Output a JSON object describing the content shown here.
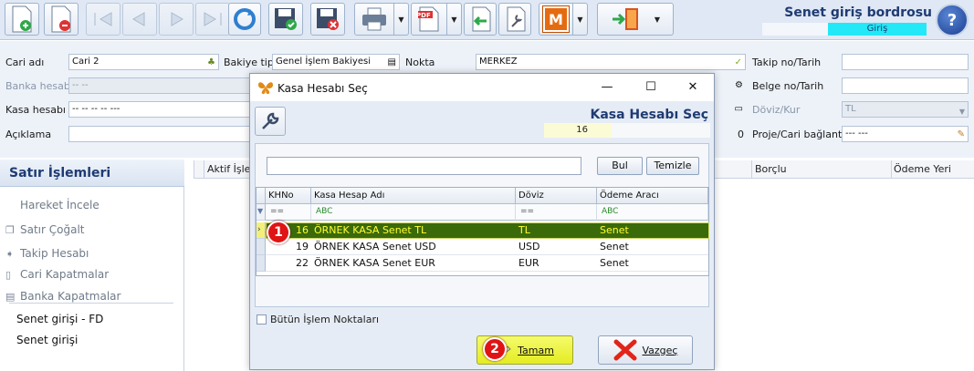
{
  "header": {
    "title": "Senet giriş bordrosu",
    "status": "Giriş",
    "help": "?"
  },
  "toolbar": {
    "pdf_label": "PDF",
    "m_label": "M"
  },
  "form": {
    "cari_adi_label": "Cari adı",
    "cari_adi_value": "Cari 2",
    "bakiye_tipi_label": "Bakiye tipi",
    "bakiye_tipi_value": "Genel İşlem Bakiyesi",
    "nokta_label": "Nokta",
    "nokta_value": "MERKEZ",
    "takip_label": "Takip no/Tarih",
    "banka_label": "Banka hesabı",
    "banka_value": "-- --",
    "belge_label": "Belge no/Tarih",
    "kasa_label": "Kasa hesabı",
    "kasa_value": "-- -- -- -- ---",
    "doviz_label": "Döviz/Kur",
    "doviz_value": "TL",
    "aciklama_label": "Açıklama",
    "proje_label": "Proje/Cari bağlantı",
    "proje_value": "--- ---",
    "zero_value": "0"
  },
  "left_panel": {
    "title": "Satır İşlemleri",
    "items": [
      {
        "label": "Hareket İncele"
      },
      {
        "label": "Satır Çoğalt"
      },
      {
        "label": "Takip Hesabı"
      },
      {
        "label": "Cari Kapatmalar"
      },
      {
        "label": "Banka Kapatmalar"
      },
      {
        "label": "Senet girişi - FD"
      },
      {
        "label": "Senet girişi"
      }
    ]
  },
  "grid": {
    "col_aktif": "Aktif İşlem",
    "col_borclu": "Borçlu",
    "col_odeme": "Ödeme Yeri"
  },
  "dialog": {
    "title": "Kasa Hesabı Seç",
    "header_title": "Kasa Hesabı Seç",
    "count": "16",
    "find_button": "Bul",
    "clear_button": "Temizle",
    "columns": [
      "KHNo",
      "Kasa Hesap Adı",
      "Döviz",
      "Ödeme Aracı"
    ],
    "filter_eq": "==",
    "filter_abc": "ABC",
    "rows": [
      {
        "khno": "16",
        "name": "ÖRNEK KASA Senet TL",
        "currency": "TL",
        "tool": "Senet"
      },
      {
        "khno": "19",
        "name": "ÖRNEK KASA Senet USD",
        "currency": "USD",
        "tool": "Senet"
      },
      {
        "khno": "22",
        "name": "ÖRNEK KASA Senet EUR",
        "currency": "EUR",
        "tool": "Senet"
      }
    ],
    "checkbox_label": "Bütün İşlem Noktaları",
    "ok_button": "Tamam",
    "cancel_button": "Vazgeç"
  },
  "badges": {
    "one": "1",
    "two": "2"
  },
  "colors": {
    "accent": "#1f3b73",
    "selected_row": "#3b6a0a",
    "selected_text": "#ffff33",
    "ok_button": "#e4ec22",
    "badge": "#e01414",
    "status": "#23e8f7"
  }
}
